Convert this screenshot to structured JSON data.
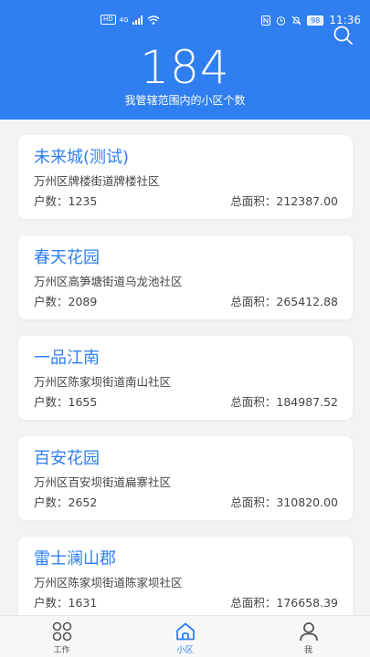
{
  "status_bar": {
    "hd": "HD",
    "network": "4G",
    "battery": "98",
    "time": "11:36"
  },
  "header": {
    "count": "184",
    "subtitle": "我管辖范围内的小区个数"
  },
  "communities": [
    {
      "name": "未来城(测试)",
      "address": "万州区牌楼街道牌楼社区",
      "households": "户数：1235",
      "area": "总面积：212387.00"
    },
    {
      "name": "春天花园",
      "address": "万州区高笋塘街道乌龙池社区",
      "households": "户数：2089",
      "area": "总面积：265412.88"
    },
    {
      "name": "一品江南",
      "address": "万州区陈家坝街道南山社区",
      "households": "户数：1655",
      "area": "总面积：184987.52"
    },
    {
      "name": "百安花园",
      "address": "万州区百安坝街道扁寨社区",
      "households": "户数：2652",
      "area": "总面积：310820.00"
    },
    {
      "name": "雷士澜山郡",
      "address": "万州区陈家坝街道陈家坝社区",
      "households": "户数：1631",
      "area": "总面积：176658.39"
    }
  ],
  "tabs": [
    {
      "label": "工作",
      "icon": "grid-icon",
      "active": false
    },
    {
      "label": "小区",
      "icon": "home-icon",
      "active": true
    },
    {
      "label": "我",
      "icon": "person-icon",
      "active": false
    }
  ],
  "colors": {
    "accent": "#2f7ff0",
    "background": "#f2f3f5"
  }
}
